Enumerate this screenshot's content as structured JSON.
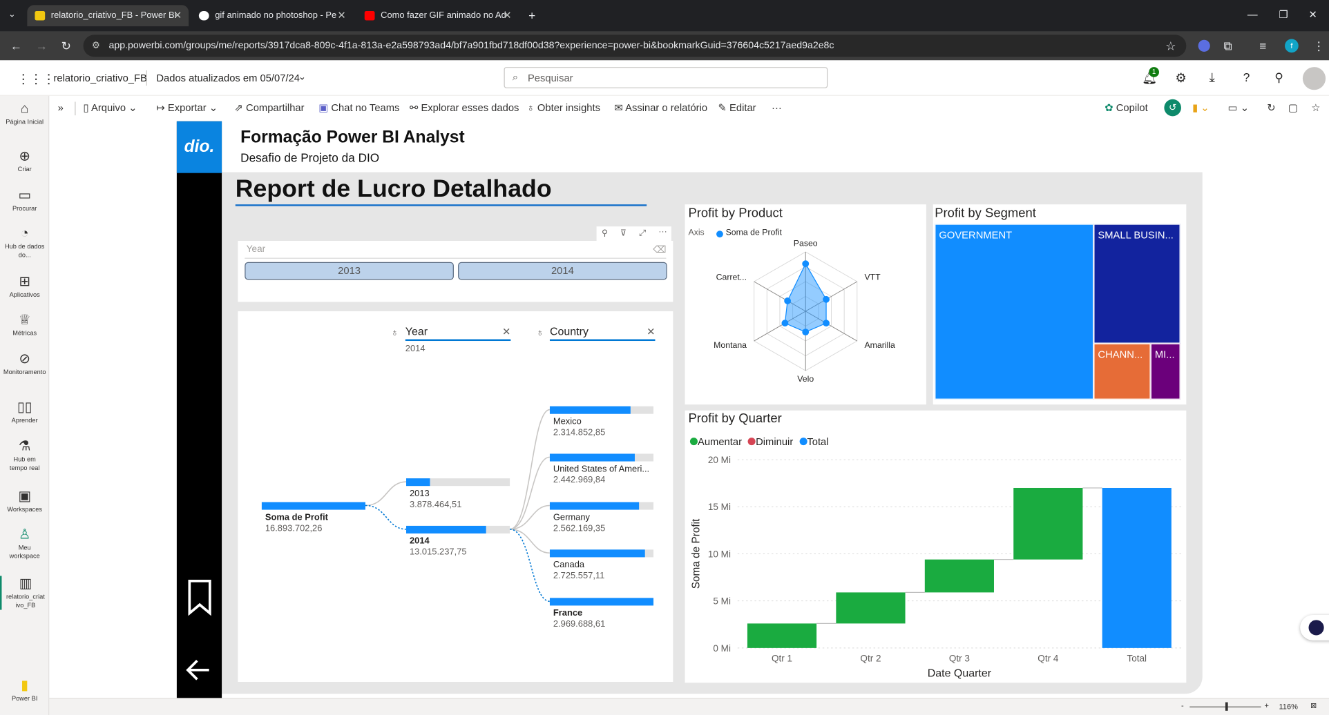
{
  "browser": {
    "tabs": [
      {
        "title": "relatorio_criativo_FB - Power BI"
      },
      {
        "title": "gif animado no photoshop - Pe"
      },
      {
        "title": "Como fazer GIF animado no Ad"
      }
    ],
    "url": "app.powerbi.com/groups/me/reports/3917dca8-809c-4f1a-813a-e2a598793ad4/bf7a901fbd718df00d38?experience=power-bi&bookmarkGuid=376604c5217aed9a2e8c"
  },
  "header": {
    "report_name": "relatorio_criativo_FB",
    "data_updated": "Dados atualizados em 05/07/24",
    "search_placeholder": "Pesquisar",
    "notification_count": "1"
  },
  "commands": {
    "arquivo": "Arquivo",
    "exportar": "Exportar",
    "compartilhar": "Compartilhar",
    "chat_teams": "Chat no Teams",
    "explorar": "Explorar esses dados",
    "insights": "Obter insights",
    "assinar": "Assinar o relatório",
    "editar": "Editar",
    "copilot": "Copilot"
  },
  "leftnav": [
    {
      "label": "Página Inicial",
      "icon": "home-icon"
    },
    {
      "label": "Criar",
      "icon": "plus-icon"
    },
    {
      "label": "Procurar",
      "icon": "folder-icon"
    },
    {
      "label": "Hub de dados do...",
      "icon": "data-hub-icon"
    },
    {
      "label": "Aplicativos",
      "icon": "apps-icon"
    },
    {
      "label": "Métricas",
      "icon": "trophy-icon"
    },
    {
      "label": "Monitoramento",
      "icon": "monitor-icon"
    },
    {
      "label": "Aprender",
      "icon": "book-icon"
    },
    {
      "label": "Hub em tempo real",
      "icon": "realtime-icon"
    },
    {
      "label": "Workspaces",
      "icon": "workspaces-icon"
    },
    {
      "label": "Meu workspace",
      "icon": "user-icon"
    },
    {
      "label": "relatorio_criativo_FB",
      "icon": "report-icon"
    },
    {
      "label": "Power BI",
      "icon": "powerbi-logo-icon"
    }
  ],
  "report": {
    "logo_text": "dio.",
    "title": "Formação Power BI Analyst",
    "subtitle": "Desafio de Projeto da DIO",
    "page_title": "Report de Lucro Detalhado"
  },
  "slicer": {
    "label": "Year",
    "options": [
      "2013",
      "2014"
    ]
  },
  "decomp": {
    "year_label": "Year",
    "year_value": "2014",
    "country_label": "Country",
    "root_label": "Soma de Profit",
    "root_value": "16.893.702,26",
    "years": [
      {
        "label": "2013",
        "value": "3.878.464,51",
        "fraction": 0.23
      },
      {
        "label": "2014",
        "value": "13.015.237,75",
        "fraction": 0.77
      }
    ],
    "countries": [
      {
        "label": "Mexico",
        "value": "2.314.852,85",
        "fraction": 0.78
      },
      {
        "label": "United States of Ameri...",
        "value": "2.442.969,84",
        "fraction": 0.82
      },
      {
        "label": "Germany",
        "value": "2.562.169,35",
        "fraction": 0.86
      },
      {
        "label": "Canada",
        "value": "2.725.557,11",
        "fraction": 0.92
      },
      {
        "label": "France",
        "value": "2.969.688,61",
        "fraction": 1.0
      }
    ]
  },
  "product_chart": {
    "title": "Profit by Product",
    "legend_axis": "Axis",
    "legend_series": "Soma de Profit",
    "axes": [
      "Paseo",
      "VTT",
      "Amarilla",
      "Velo",
      "Montana",
      "Carret..."
    ],
    "values": [
      0.8,
      0.4,
      0.4,
      0.35,
      0.4,
      0.35
    ],
    "color": "#118DFF"
  },
  "segment_chart": {
    "title": "Profit by Segment",
    "segments": [
      {
        "label": "GOVERNMENT",
        "color": "#118DFF"
      },
      {
        "label": "SMALL BUSIN...",
        "color": "#12239E"
      },
      {
        "label": "CHANN...",
        "color": "#E66C37"
      },
      {
        "label": "MI...",
        "color": "#6B007B"
      }
    ]
  },
  "chart_data": {
    "type": "waterfall",
    "title": "Profit by Quarter",
    "xlabel": "Date Quarter",
    "ylabel": "Soma de Profit",
    "categories": [
      "Qtr 1",
      "Qtr 2",
      "Qtr 3",
      "Qtr 4",
      "Total"
    ],
    "values": [
      2.6,
      3.3,
      3.5,
      7.6,
      17.0
    ],
    "y_ticks": [
      "0 Mi",
      "5 Mi",
      "10 Mi",
      "15 Mi",
      "20 Mi"
    ],
    "ylim": [
      0,
      20
    ],
    "legend": [
      "Aumentar",
      "Diminuir",
      "Total"
    ],
    "colors": {
      "Aumentar": "#1AAB40",
      "Diminuir": "#D64554",
      "Total": "#118DFF"
    }
  },
  "status": {
    "zoom": "116%"
  }
}
